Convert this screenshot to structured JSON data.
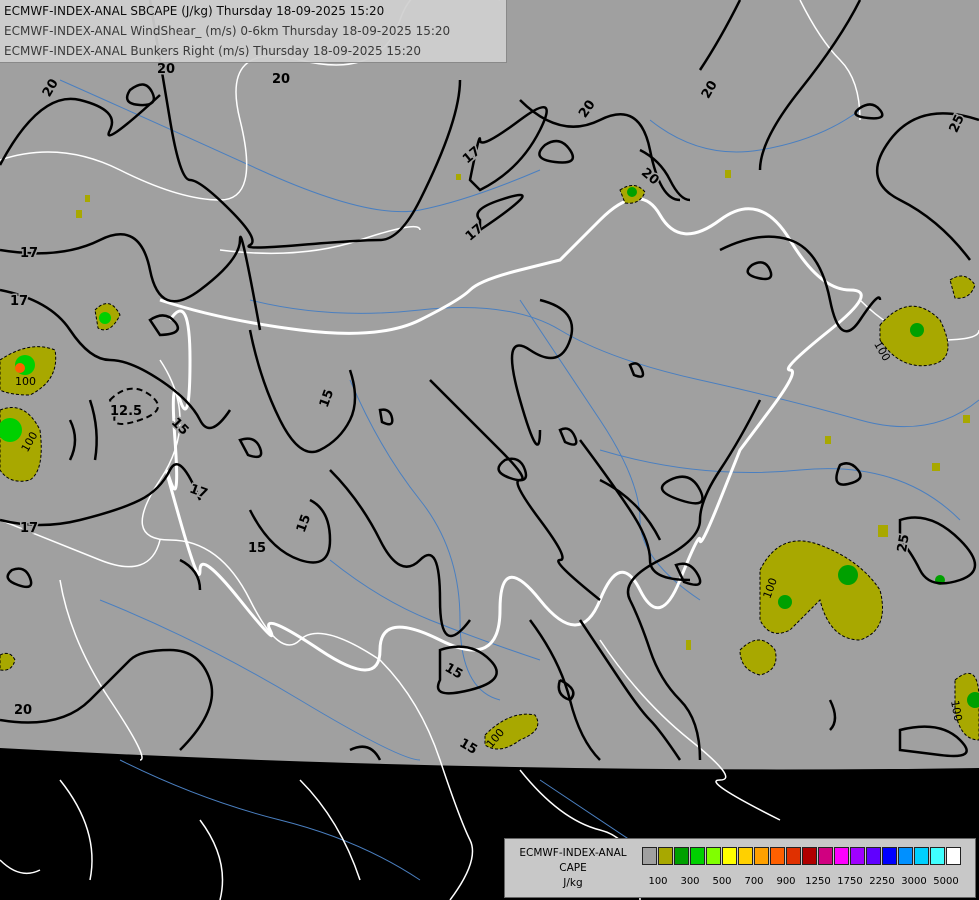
{
  "header": {
    "lines": [
      "ECMWF-INDEX-ANAL SBCAPE (J/kg) Thursday 18-09-2025 15:20",
      "ECMWF-INDEX-ANAL WindShear_ (m/s) 0-6km Thursday 18-09-2025 15:20",
      "ECMWF-INDEX-ANAL Bunkers Right (m/s) Thursday 18-09-2025 15:20"
    ]
  },
  "contour_labels": {
    "shear": [
      "20",
      "20",
      "20",
      "20",
      "20",
      "17",
      "17",
      "17",
      "17",
      "17",
      "15",
      "15",
      "15",
      "15",
      "15",
      "15",
      "12.5",
      "25",
      "25",
      "20"
    ],
    "cape": [
      "100",
      "100",
      "100",
      "100",
      "100",
      "100"
    ]
  },
  "legend": {
    "title_lines": [
      "ECMWF-INDEX-ANAL",
      "CAPE",
      "J/kg"
    ],
    "tick_labels": [
      "100",
      "300",
      "500",
      "700",
      "900",
      "1250",
      "1750",
      "2250",
      "3000",
      "5000"
    ],
    "colors": [
      "#a0a0a0",
      "#a8a800",
      "#00a000",
      "#00d000",
      "#80ff00",
      "#ffff00",
      "#ffd000",
      "#ffa000",
      "#ff6000",
      "#e03000",
      "#b00000",
      "#d00080",
      "#ff00ff",
      "#a000ff",
      "#6000ff",
      "#0000ff",
      "#0090ff",
      "#00d0ff",
      "#40ffff",
      "#ffffff"
    ]
  },
  "colors": {
    "background": "#000000",
    "domain": "#a0a0a0",
    "rivers": "#4a7fc0",
    "borders": "#ffffff",
    "shear_contours": "#000000",
    "cape_fill": "#a8a800"
  }
}
